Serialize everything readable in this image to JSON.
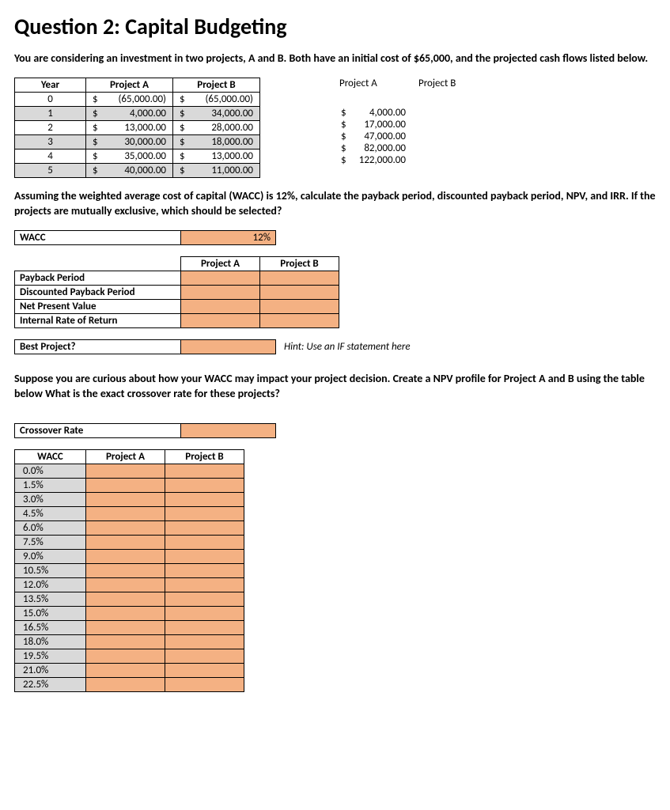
{
  "title": "Question 2: Capital Budgeting",
  "intro": "You are considering an investment in two projects, A and B.  Both have an initial cost of $65,000, and the projected cash flows listed below.",
  "cashflows": {
    "headers": {
      "year": "Year",
      "a": "Project A",
      "b": "Project B"
    },
    "rows": [
      {
        "year": "0",
        "a_d": "$",
        "a_v": "(65,000.00)",
        "b_d": "$",
        "b_v": "(65,000.00)"
      },
      {
        "year": "1",
        "a_d": "$",
        "a_v": "4,000.00",
        "b_d": "$",
        "b_v": "34,000.00"
      },
      {
        "year": "2",
        "a_d": "$",
        "a_v": "13,000.00",
        "b_d": "$",
        "b_v": "28,000.00"
      },
      {
        "year": "3",
        "a_d": "$",
        "a_v": "30,000.00",
        "b_d": "$",
        "b_v": "18,000.00"
      },
      {
        "year": "4",
        "a_d": "$",
        "a_v": "35,000.00",
        "b_d": "$",
        "b_v": "13,000.00"
      },
      {
        "year": "5",
        "a_d": "$",
        "a_v": "40,000.00",
        "b_d": "$",
        "b_v": "11,000.00"
      }
    ]
  },
  "sidecalc": {
    "hdr_a": "Project A",
    "hdr_b": "Project B",
    "rows": [
      {
        "d": "$",
        "v": "4,000.00"
      },
      {
        "d": "$",
        "v": "17,000.00"
      },
      {
        "d": "$",
        "v": "47,000.00"
      },
      {
        "d": "$",
        "v": "82,000.00"
      },
      {
        "d": "$",
        "v": "122,000.00"
      }
    ]
  },
  "para2": "Assuming the weighted average cost of capital (WACC) is 12%, calculate the payback period, discounted payback period, NPV, and IRR.  If the projects are mutually exclusive, which should be selected?",
  "wacc": {
    "label": "WACC",
    "value": "12%"
  },
  "metrics": {
    "col_a": "Project A",
    "col_b": "Project B",
    "rows": [
      "Payback Period",
      "Discounted Payback Period",
      "Net Present Value",
      "Internal Rate of Return"
    ]
  },
  "best": {
    "label": "Best Project?",
    "hint": "Hint: Use an IF statement here"
  },
  "para3": "Suppose you are curious about how your WACC may impact your project decision.  Create a NPV profile for Project A and B using the table below  What is the exact crossover rate for these projects?",
  "crossover": {
    "label": "Crossover Rate"
  },
  "npvprofile": {
    "headers": {
      "wacc": "WACC",
      "a": "Project A",
      "b": "Project B"
    },
    "rates": [
      "0.0%",
      "1.5%",
      "3.0%",
      "4.5%",
      "6.0%",
      "7.5%",
      "9.0%",
      "10.5%",
      "12.0%",
      "13.5%",
      "15.0%",
      "16.5%",
      "18.0%",
      "19.5%",
      "21.0%",
      "22.5%"
    ]
  }
}
